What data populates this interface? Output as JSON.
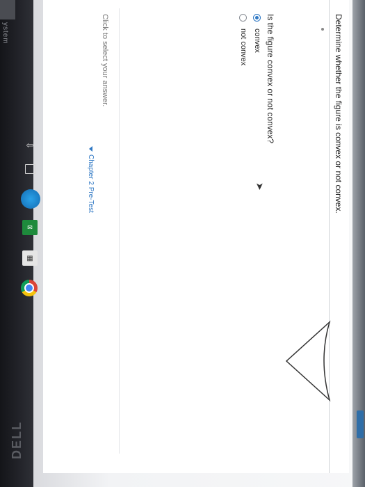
{
  "window": {
    "side_label": "ystem"
  },
  "taskbar": {
    "icons": [
      "back-arrow-icon",
      "task-view-icon",
      "cortana-icon",
      "mail-icon",
      "store-icon",
      "chrome-icon"
    ],
    "mail_glyph": "✉",
    "store_glyph": "▦",
    "back_glyph": "⇦",
    "brand": "DELL"
  },
  "question": {
    "title": "Determine whether the figure is convex or not convex.",
    "prompt": "Is the figure convex or not convex?",
    "options": [
      {
        "label": "convex",
        "selected": true
      },
      {
        "label": "not convex",
        "selected": false
      }
    ],
    "answer_hint": "Click to select your answer.",
    "chapter_link": "Chapter 2 Pre-Test"
  },
  "colors": {
    "accent": "#2f78c4",
    "taskbar": "#23242a"
  }
}
